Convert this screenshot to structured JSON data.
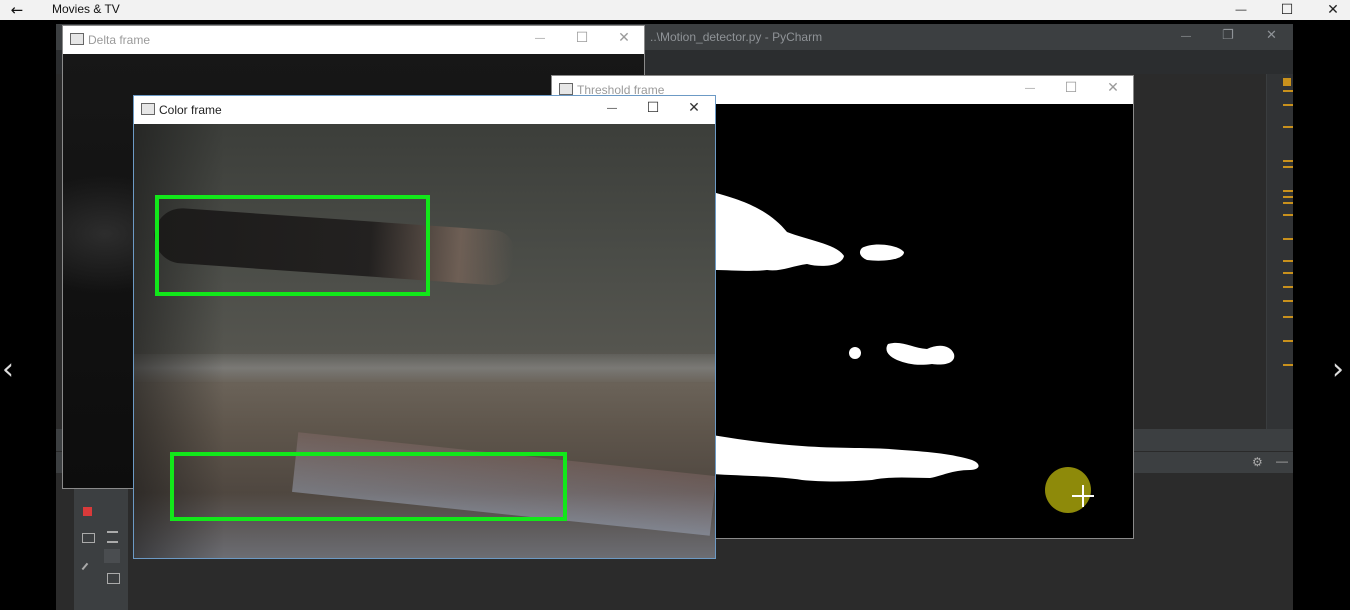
{
  "app": {
    "title": "Movies & TV",
    "back_glyph": "←",
    "minimize_glyph": "—",
    "maximize_glyph": "☐",
    "close_glyph": "✕",
    "prev_glyph": "‹",
    "next_glyph": "›"
  },
  "pycharm": {
    "title": "..\\Motion_detector.py - PyCharm",
    "min": "—",
    "max": "❐",
    "close": "✕",
    "gear": "⚙",
    "dash": "—"
  },
  "windows": {
    "delta": {
      "title": "Delta frame"
    },
    "threshold": {
      "title": "Threshold frame"
    },
    "color": {
      "title": "Color frame"
    },
    "min": "—",
    "max": "☐",
    "close": "✕"
  },
  "colors": {
    "box": "#12e81a",
    "cursor": "#8e8a0a",
    "editor": "#2b2b2b"
  },
  "icons": [
    "arrow-left-icon",
    "minimize-icon",
    "maximize-icon",
    "close-icon",
    "chevron-left-icon",
    "chevron-right-icon",
    "gear-icon",
    "stop-icon",
    "window-icon"
  ]
}
